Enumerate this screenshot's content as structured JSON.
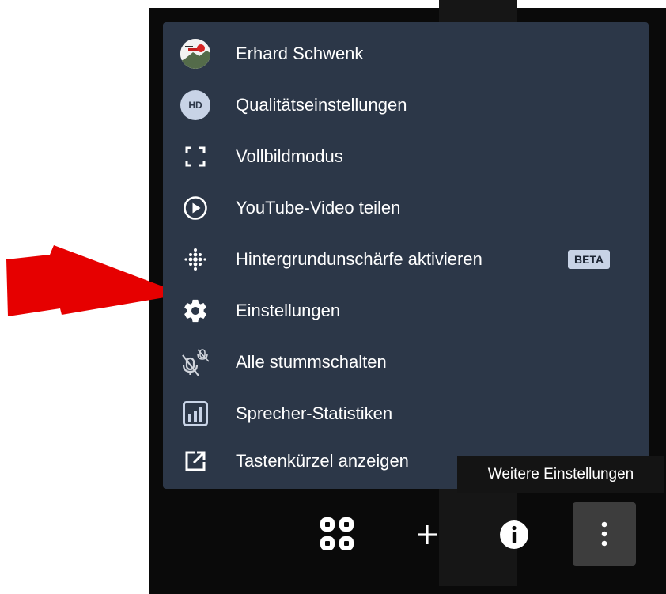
{
  "menu": {
    "items": [
      {
        "id": "profile",
        "label": "Erhard Schwenk",
        "icon": "user-avatar-icon"
      },
      {
        "id": "quality",
        "label": "Qualitätseinstellungen",
        "icon": "hd-icon"
      },
      {
        "id": "fullscreen",
        "label": "Vollbildmodus",
        "icon": "fullscreen-icon"
      },
      {
        "id": "share-video",
        "label": "YouTube-Video teilen",
        "icon": "play-circle-icon"
      },
      {
        "id": "background-blur",
        "label": "Hintergrundunschärfe aktivieren",
        "icon": "blur-icon",
        "badge": "BETA"
      },
      {
        "id": "settings",
        "label": "Einstellungen",
        "icon": "gear-icon"
      },
      {
        "id": "mute-all",
        "label": "Alle stummschalten",
        "icon": "mute-all-icon"
      },
      {
        "id": "speaker-stats",
        "label": "Sprecher-Statistiken",
        "icon": "bar-chart-icon"
      },
      {
        "id": "shortcuts",
        "label": "Tastenkürzel anzeigen",
        "icon": "external-link-icon"
      }
    ]
  },
  "hd_badge_text": "HD",
  "tooltip": {
    "text": "Weitere Einstellungen"
  },
  "toolbar": {
    "tile_view_icon": "grid-icon",
    "add_icon": "plus-icon",
    "info_icon": "info-icon",
    "more_icon": "more-vertical-icon"
  },
  "colors": {
    "menu_bg": "#2c3748",
    "accent_badge": "#c8d3e6",
    "arrow": "#e60000",
    "tooltip_bg": "#141414"
  }
}
